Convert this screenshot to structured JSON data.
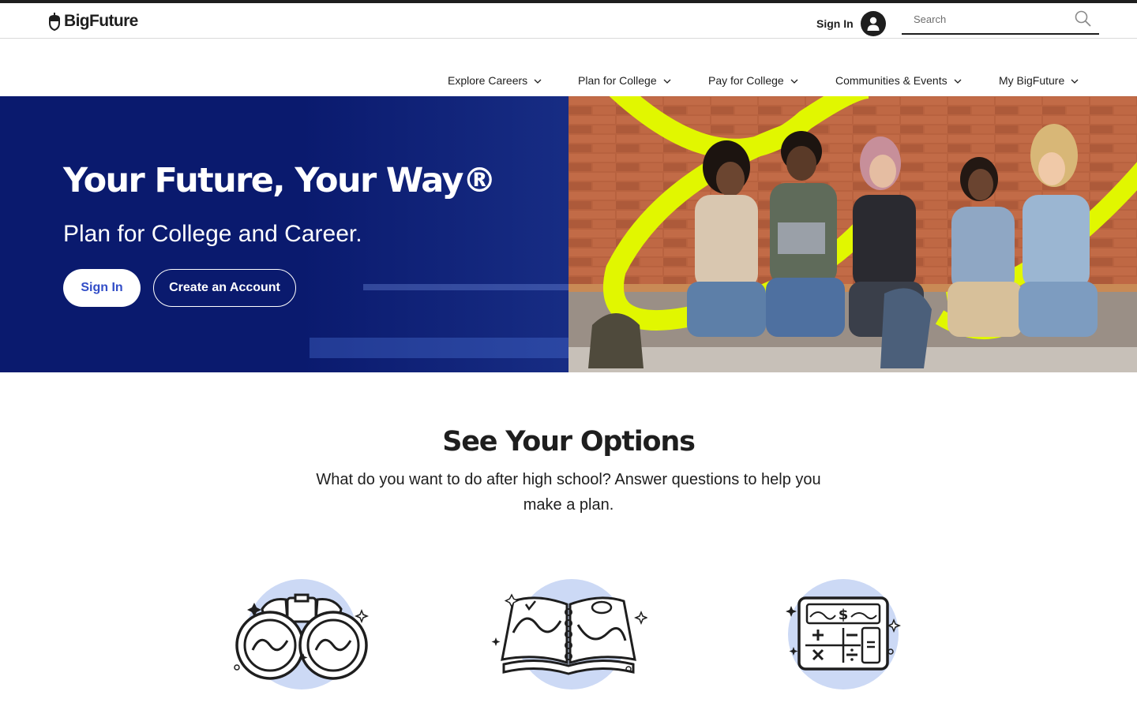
{
  "header": {
    "logo_text": "BigFuture",
    "signin_label": "Sign In",
    "search_placeholder": "Search"
  },
  "nav": {
    "items": [
      {
        "label": "Explore Careers"
      },
      {
        "label": "Plan for College"
      },
      {
        "label": "Pay for College"
      },
      {
        "label": "Communities & Events"
      },
      {
        "label": "My BigFuture"
      }
    ]
  },
  "hero": {
    "title": "Your Future, Your Way®",
    "subtitle": "Plan for College and Career.",
    "signin_button": "Sign In",
    "create_button": "Create an Account"
  },
  "options": {
    "title": "See Your Options",
    "description": "What do you want to do after high school? Answer questions to help you make a plan.",
    "illustrations": [
      "binoculars-icon",
      "map-book-icon",
      "calculator-icon"
    ]
  },
  "colors": {
    "hero_navy": "#0a1a6e",
    "signin_text_blue": "#324dc7",
    "accent_lime": "#e1f700",
    "illustration_circle": "#ccd9f5",
    "text_dark": "#1e1e1e"
  }
}
